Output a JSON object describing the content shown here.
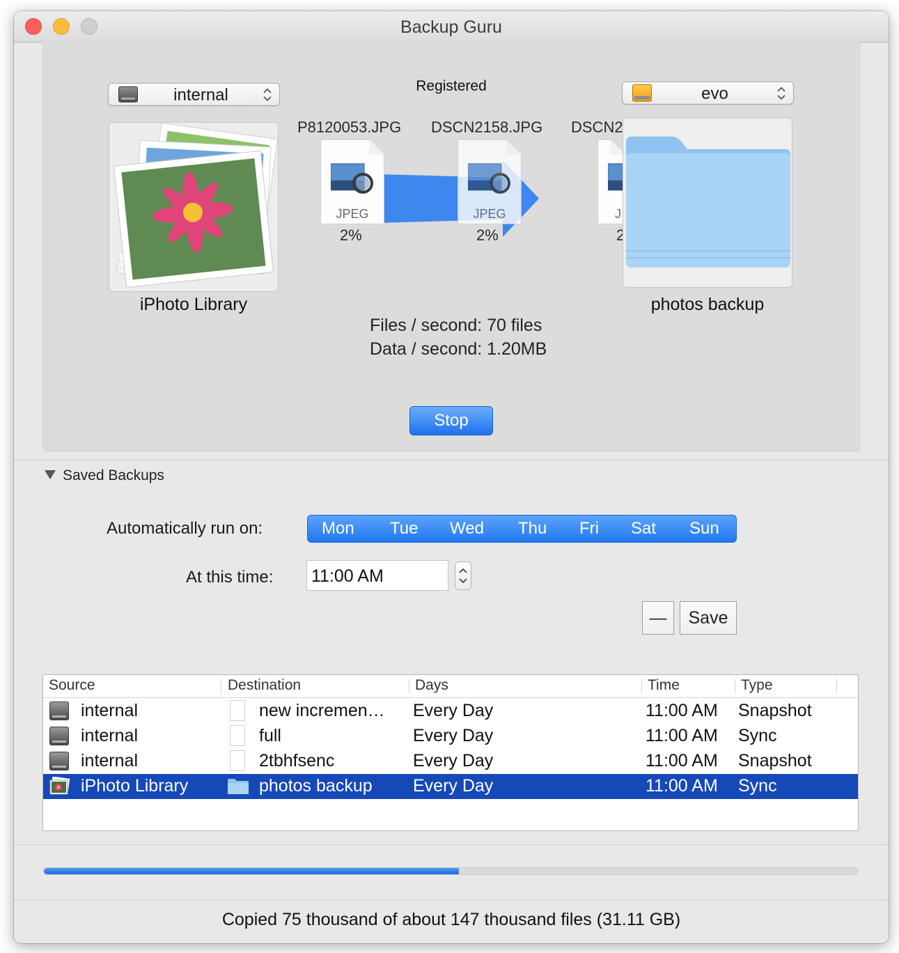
{
  "window": {
    "title": "Backup Guru"
  },
  "registration_status": "Registered",
  "source": {
    "drive_label": "internal",
    "item_label": "iPhoto Library"
  },
  "destination": {
    "drive_label": "evo",
    "item_label": "photos backup"
  },
  "transfer": {
    "files": [
      {
        "name": "P8120053.JPG",
        "type": "JPEG",
        "percent": "2%"
      },
      {
        "name": "DSCN2158.JPG",
        "type": "JPEG",
        "percent": "2%"
      },
      {
        "name": "DSCN2",
        "type": "J",
        "percent": "2"
      }
    ],
    "files_per_second": "Files / second: 70 files",
    "data_per_second": "Data / second: 1.20MB",
    "stop_label": "Stop"
  },
  "saved_backups": {
    "header": "Saved Backups",
    "auto_run_label": "Automatically run on:",
    "days": [
      "Mon",
      "Tue",
      "Wed",
      "Thu",
      "Fri",
      "Sat",
      "Sun"
    ],
    "time_label": "At this time:",
    "time_value": "11:00 AM",
    "remove_label": "—",
    "save_label": "Save"
  },
  "table": {
    "columns": [
      "Source",
      "Destination",
      "Days",
      "Time",
      "Type"
    ],
    "rows": [
      {
        "source": "internal",
        "destination": "new incremen…",
        "days": "Every Day",
        "time": "11:00 AM",
        "type": "Snapshot",
        "source_icon": "hard-drive-icon",
        "destination_icon": "document-icon"
      },
      {
        "source": "internal",
        "destination": "full",
        "days": "Every Day",
        "time": "11:00 AM",
        "type": "Sync",
        "source_icon": "hard-drive-icon",
        "destination_icon": "document-icon"
      },
      {
        "source": "internal",
        "destination": "2tbhfsenc",
        "days": "Every Day",
        "time": "11:00 AM",
        "type": "Snapshot",
        "source_icon": "hard-drive-icon",
        "destination_icon": "document-icon"
      },
      {
        "source": "iPhoto Library",
        "destination": "photos backup",
        "days": "Every Day",
        "time": "11:00 AM",
        "type": "Sync",
        "source_icon": "iphoto-icon",
        "destination_icon": "folder-icon",
        "selected": true
      }
    ]
  },
  "progress": {
    "fraction": 0.51
  },
  "status_text": "Copied 75 thousand of about 147 thousand files (31.11 GB)",
  "colors": {
    "accent": "#2278f0",
    "selection": "#1649b8",
    "folder": "#a9d4f5"
  }
}
